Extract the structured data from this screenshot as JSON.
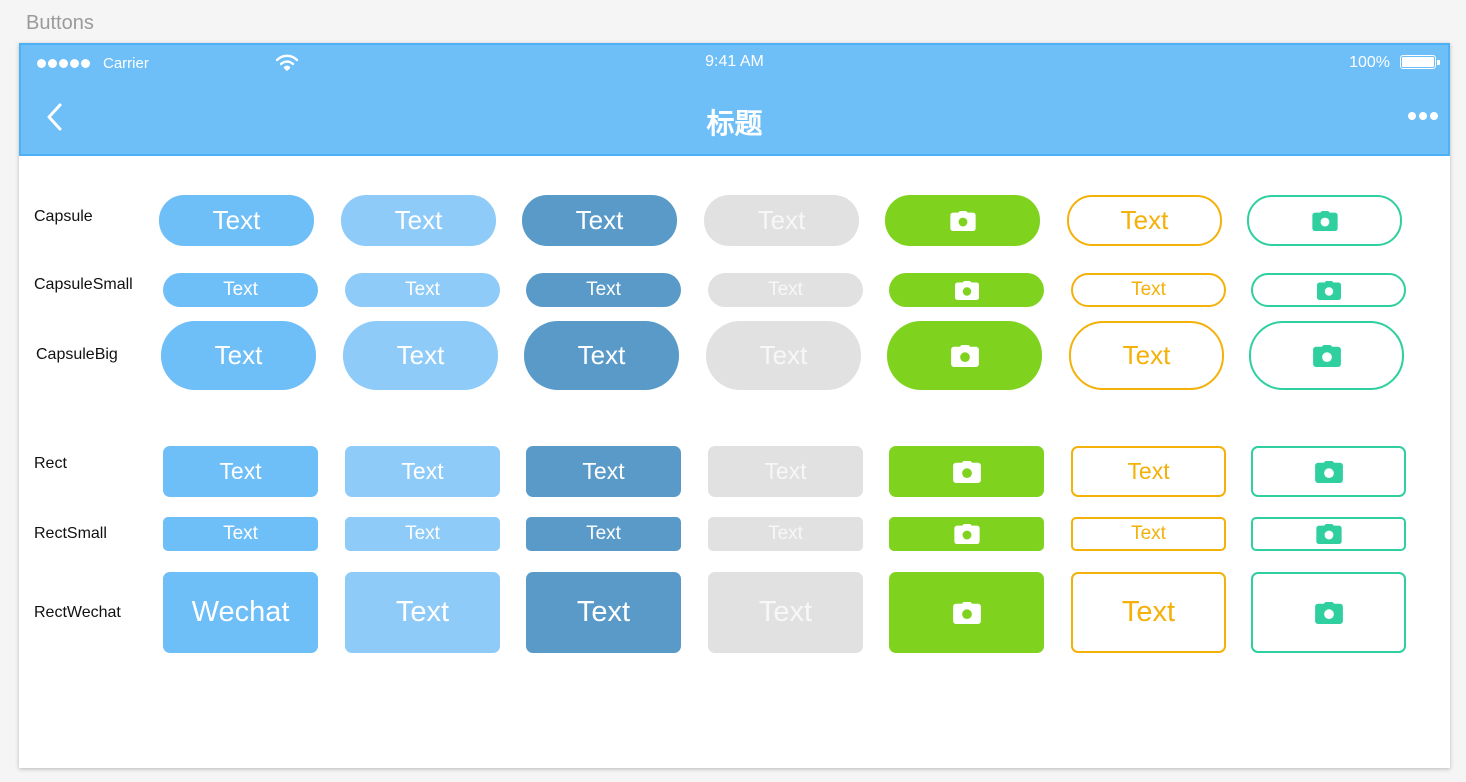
{
  "artboard": {
    "title": "Buttons"
  },
  "status_bar": {
    "carrier": "Carrier",
    "time": "9:41 AM",
    "battery": "100%"
  },
  "nav_bar": {
    "title": "标题",
    "back_icon": "chevron-left-icon",
    "more_icon": "more-icon"
  },
  "colors": {
    "header": "#6ebef8",
    "blue": "#6ebef8",
    "light_blue": "#8ecbf8",
    "dark_blue": "#5a9ac8",
    "gray": "#e1e1e1",
    "green": "#7fd31f",
    "orange": "#f3b10a",
    "teal": "#2fcf9f"
  },
  "rows": [
    {
      "label": "Capsule",
      "buttons": [
        "Text",
        "Text",
        "Text",
        "Text",
        "camera-icon",
        "Text",
        "camera-icon"
      ]
    },
    {
      "label": "CapsuleSmall",
      "buttons": [
        "Text",
        "Text",
        "Text",
        "Text",
        "camera-icon",
        "Text",
        "camera-icon"
      ]
    },
    {
      "label": "CapsuleBig",
      "buttons": [
        "Text",
        "Text",
        "Text",
        "Text",
        "camera-icon",
        "Text",
        "camera-icon"
      ]
    },
    {
      "label": "Rect",
      "buttons": [
        "Text",
        "Text",
        "Text",
        "Text",
        "camera-icon",
        "Text",
        "camera-icon"
      ]
    },
    {
      "label": "RectSmall",
      "buttons": [
        "Text",
        "Text",
        "Text",
        "Text",
        "camera-icon",
        "Text",
        "camera-icon"
      ]
    },
    {
      "label": "RectWechat",
      "buttons": [
        "Wechat",
        "Text",
        "Text",
        "Text",
        "camera-icon",
        "Text",
        "camera-icon"
      ]
    }
  ]
}
